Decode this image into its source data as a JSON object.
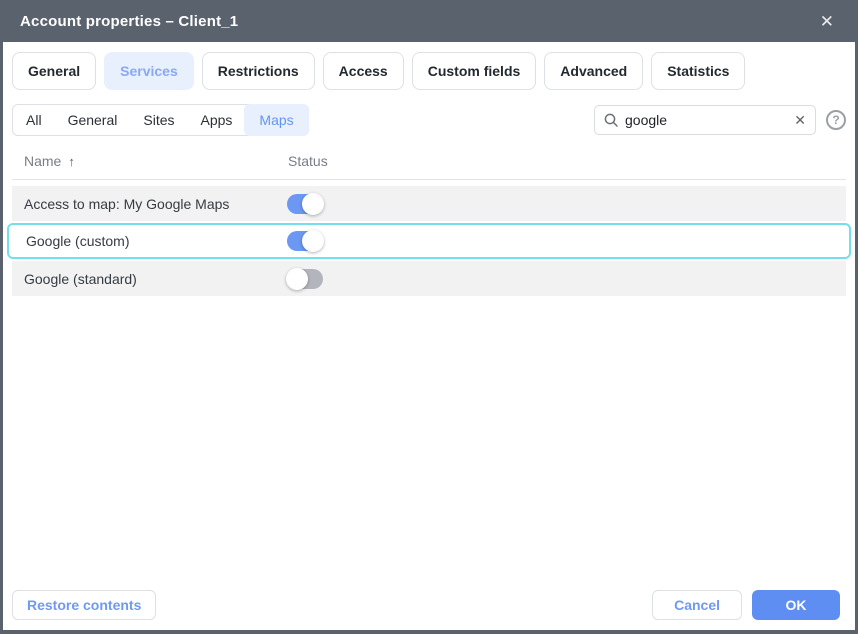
{
  "window": {
    "title": "Account properties – Client_1",
    "close_icon": "✕"
  },
  "tabs": {
    "items": [
      {
        "label": "General",
        "active": false
      },
      {
        "label": "Services",
        "active": true
      },
      {
        "label": "Restrictions",
        "active": false
      },
      {
        "label": "Access",
        "active": false
      },
      {
        "label": "Custom fields",
        "active": false
      },
      {
        "label": "Advanced",
        "active": false
      },
      {
        "label": "Statistics",
        "active": false
      }
    ]
  },
  "filter_tabs": {
    "items": [
      {
        "label": "All",
        "active": false
      },
      {
        "label": "General",
        "active": false
      },
      {
        "label": "Sites",
        "active": false
      },
      {
        "label": "Apps",
        "active": false
      },
      {
        "label": "Maps",
        "active": true
      }
    ]
  },
  "search": {
    "value": "google",
    "clear_icon": "✕",
    "help_icon": "?"
  },
  "table": {
    "columns": {
      "name": "Name",
      "sort_arrow": "↑",
      "status": "Status"
    },
    "rows": [
      {
        "name": "Access to map: My Google Maps",
        "enabled": true,
        "selected": false
      },
      {
        "name": "Google (custom)",
        "enabled": true,
        "selected": true
      },
      {
        "name": "Google (standard)",
        "enabled": false,
        "selected": false
      }
    ]
  },
  "footer": {
    "restore_label": "Restore contents",
    "cancel_label": "Cancel",
    "ok_label": "OK"
  },
  "colors": {
    "titlebar": "#5a626e",
    "accent_blue": "#5e8ef2",
    "active_tab_bg": "#e8effd",
    "active_tab_text": "#8aa9f4",
    "filter_active_text": "#6496f0",
    "selected_row_border": "#74dfe9",
    "toggle_on": "#6c97f3",
    "toggle_off": "#b2b6bc",
    "row_bg": "#f2f2f3"
  }
}
